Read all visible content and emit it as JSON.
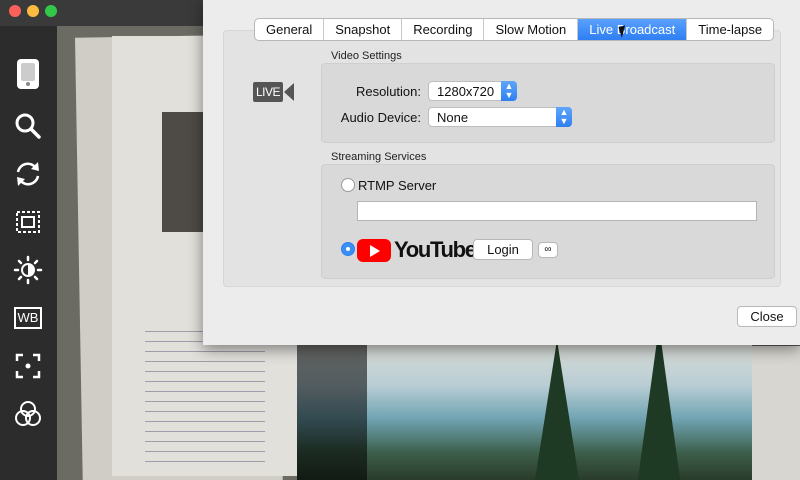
{
  "window": {
    "controls": [
      "close",
      "minimize",
      "zoom"
    ]
  },
  "sidebar": {
    "items": [
      {
        "icon": "device-icon"
      },
      {
        "icon": "magnifier-icon"
      },
      {
        "icon": "rotate-icon"
      },
      {
        "icon": "crop-icon"
      },
      {
        "icon": "brightness-icon"
      },
      {
        "label": "WB",
        "icon": "white-balance-icon"
      },
      {
        "icon": "focus-icon"
      },
      {
        "icon": "color-circles-icon"
      }
    ]
  },
  "preferences": {
    "tabs": [
      "General",
      "Snapshot",
      "Recording",
      "Slow Motion",
      "Live Broadcast",
      "Time-lapse"
    ],
    "active_tab": "Live Broadcast",
    "live_icon_text": "LIVE",
    "video_settings": {
      "title": "Video Settings",
      "resolution_label": "Resolution:",
      "resolution_value": "1280x720",
      "audio_label": "Audio Device:",
      "audio_value": "None"
    },
    "streaming": {
      "title": "Streaming Services",
      "rtmp_label": "RTMP Server",
      "rtmp_selected": false,
      "rtmp_value": "",
      "youtube_selected": true,
      "youtube_wordmark": "YouTube",
      "login_label": "Login",
      "link_label": "∞"
    },
    "close_label": "Close"
  },
  "colors": {
    "accent": "#2f7ff3",
    "youtube_red": "#ff0000"
  }
}
